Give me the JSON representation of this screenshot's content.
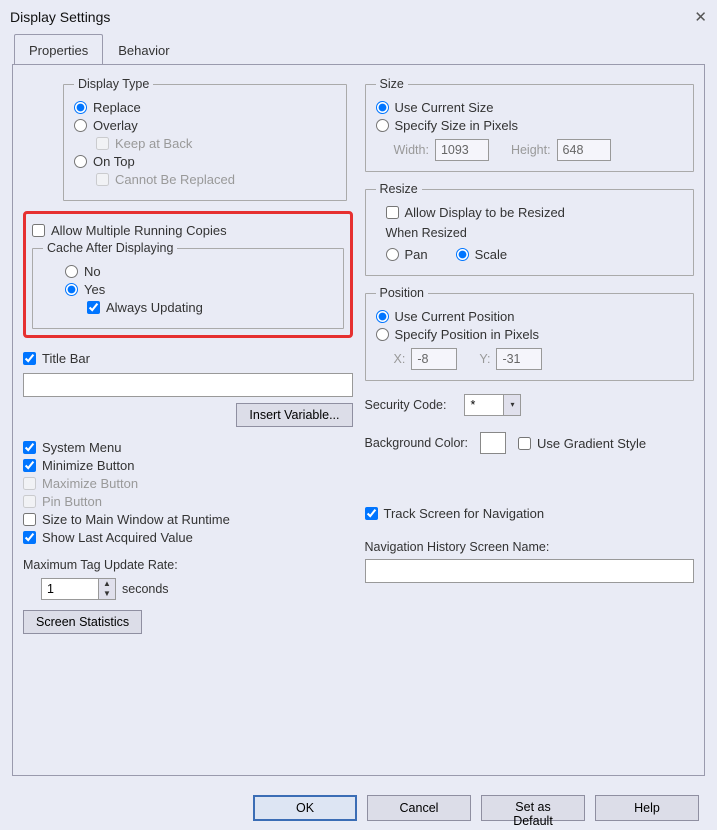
{
  "dialog": {
    "title": "Display Settings",
    "closeGlyph": "✕"
  },
  "tabs": {
    "properties": "Properties",
    "behavior": "Behavior",
    "active": "properties"
  },
  "displayType": {
    "legend": "Display Type",
    "replace": "Replace",
    "overlay": "Overlay",
    "keepAtBack": "Keep at Back",
    "onTop": "On Top",
    "cannotBeReplaced": "Cannot Be Replaced",
    "selected": "replace"
  },
  "allowMultiple": {
    "label": "Allow Multiple Running Copies",
    "checked": false
  },
  "cache": {
    "legend": "Cache After Displaying",
    "no": "No",
    "yes": "Yes",
    "alwaysUpdating": "Always Updating",
    "selected": "yes",
    "alwaysUpdatingChecked": true
  },
  "titleBar": {
    "label": "Title Bar",
    "checked": true,
    "value": "",
    "insertVariable": "Insert Variable..."
  },
  "windowOpts": {
    "systemMenu": {
      "label": "System Menu",
      "checked": true
    },
    "minimizeButton": {
      "label": "Minimize Button",
      "checked": true
    },
    "maximizeButton": {
      "label": "Maximize Button",
      "checked": false,
      "disabled": true
    },
    "pinButton": {
      "label": "Pin Button",
      "checked": false,
      "disabled": true
    },
    "sizeToMain": {
      "label": "Size to Main Window at Runtime",
      "checked": false
    },
    "showLastAcquired": {
      "label": "Show Last Acquired Value",
      "checked": true
    }
  },
  "tagRate": {
    "label": "Maximum Tag Update Rate:",
    "value": "1",
    "unit": "seconds"
  },
  "screenStats": "Screen Statistics",
  "size": {
    "legend": "Size",
    "useCurrent": "Use Current Size",
    "specify": "Specify Size in Pixels",
    "widthLabel": "Width:",
    "widthValue": "1093",
    "heightLabel": "Height:",
    "heightValue": "648",
    "selected": "useCurrent"
  },
  "resize": {
    "legend": "Resize",
    "allow": "Allow Display to be Resized",
    "allowChecked": false,
    "whenResized": "When Resized",
    "pan": "Pan",
    "scale": "Scale",
    "selected": "scale"
  },
  "position": {
    "legend": "Position",
    "useCurrent": "Use Current Position",
    "specify": "Specify Position in Pixels",
    "xLabel": "X:",
    "xValue": "-8",
    "yLabel": "Y:",
    "yValue": "-31",
    "selected": "useCurrent"
  },
  "security": {
    "label": "Security Code:",
    "value": "*"
  },
  "bgColor": {
    "label": "Background Color:",
    "useGradient": "Use Gradient Style",
    "useGradientChecked": false
  },
  "trackScreen": {
    "label": "Track Screen for Navigation",
    "checked": true
  },
  "navHistory": {
    "label": "Navigation History Screen Name:",
    "value": ""
  },
  "buttons": {
    "ok": "OK",
    "cancel": "Cancel",
    "setDefault": "Set as Default",
    "help": "Help"
  }
}
